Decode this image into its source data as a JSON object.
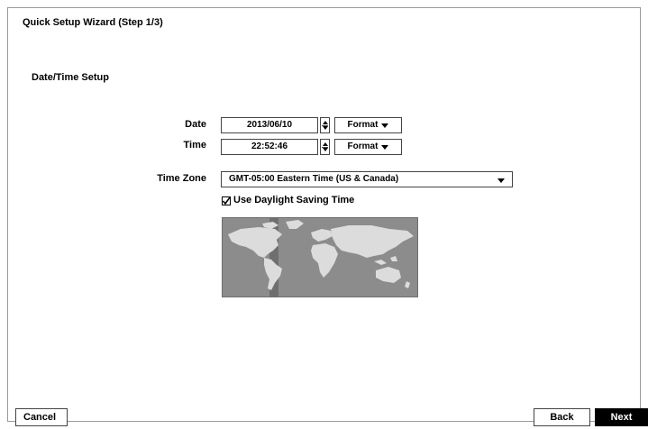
{
  "window": {
    "title": "Quick Setup Wizard (Step 1/3)"
  },
  "section": {
    "title": "Date/Time Setup"
  },
  "date": {
    "label": "Date",
    "value": "2013/06/10",
    "format_label": "Format"
  },
  "time": {
    "label": "Time",
    "value": "22:52:46",
    "format_label": "Format"
  },
  "timezone": {
    "label": "Time Zone",
    "value": "GMT-05:00 Eastern Time (US & Canada)"
  },
  "dst": {
    "label": "Use Daylight Saving Time",
    "checked": true
  },
  "map": {
    "icon": "world-map-timezone"
  },
  "footer": {
    "cancel": "Cancel",
    "back": "Back",
    "next": "Next"
  }
}
